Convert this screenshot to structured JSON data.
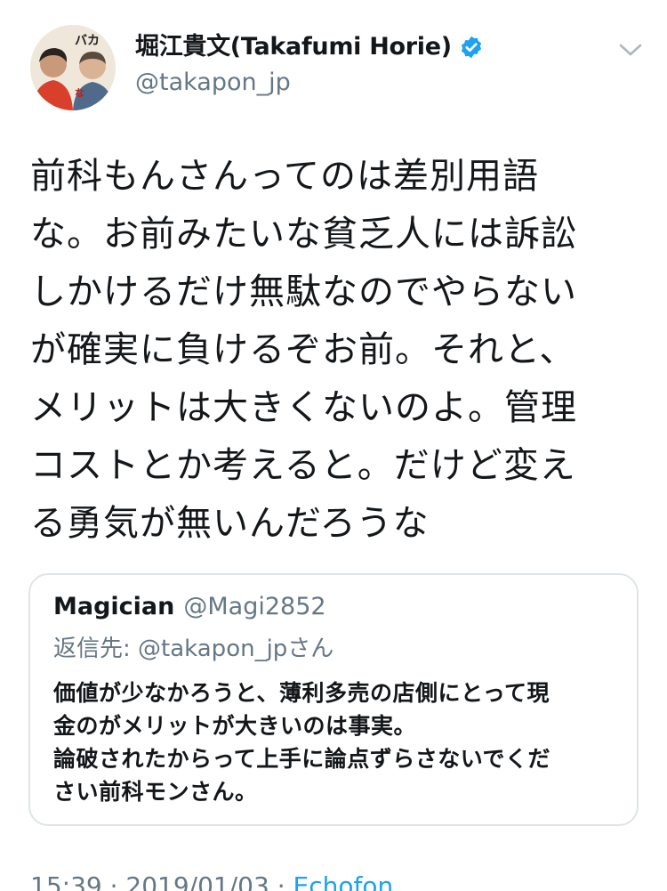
{
  "author": {
    "display_name": "堀江貴文(Takafumi Horie)",
    "handle": "@takapon_jp",
    "verified": true,
    "avatar_text": "バカとつき合うな"
  },
  "tweet": {
    "text": "前科もんさんってのは差別用語\nな。お前みたいな貧乏人には訴訟\nしかけるだけ無駄なのでやらない\nが確実に負けるぞお前。それと、\nメリットは大きくないのよ。管理\nコストとか考えると。だけど変え\nる勇気が無いんだろうな"
  },
  "quoted_tweet": {
    "name": "Magician",
    "handle": "@Magi2852",
    "reply_to": "返信先: @takapon_jpさん",
    "text": "価値が少なかろうと、薄利多売の店側にとって現\n金のがメリットが大きいのは事実。\n論破されたからって上手に論点ずらさないでくだ\nさい前科モンさん。"
  },
  "meta": {
    "time": "15:39",
    "date": "2019/01/03",
    "separator": "·",
    "source": "Echofon"
  },
  "colors": {
    "accent": "#1da1f2",
    "secondary_text": "#657786",
    "border": "#dfe4e8"
  },
  "icons": {
    "verified": "verified-badge-icon",
    "caret": "chevron-down-icon"
  }
}
